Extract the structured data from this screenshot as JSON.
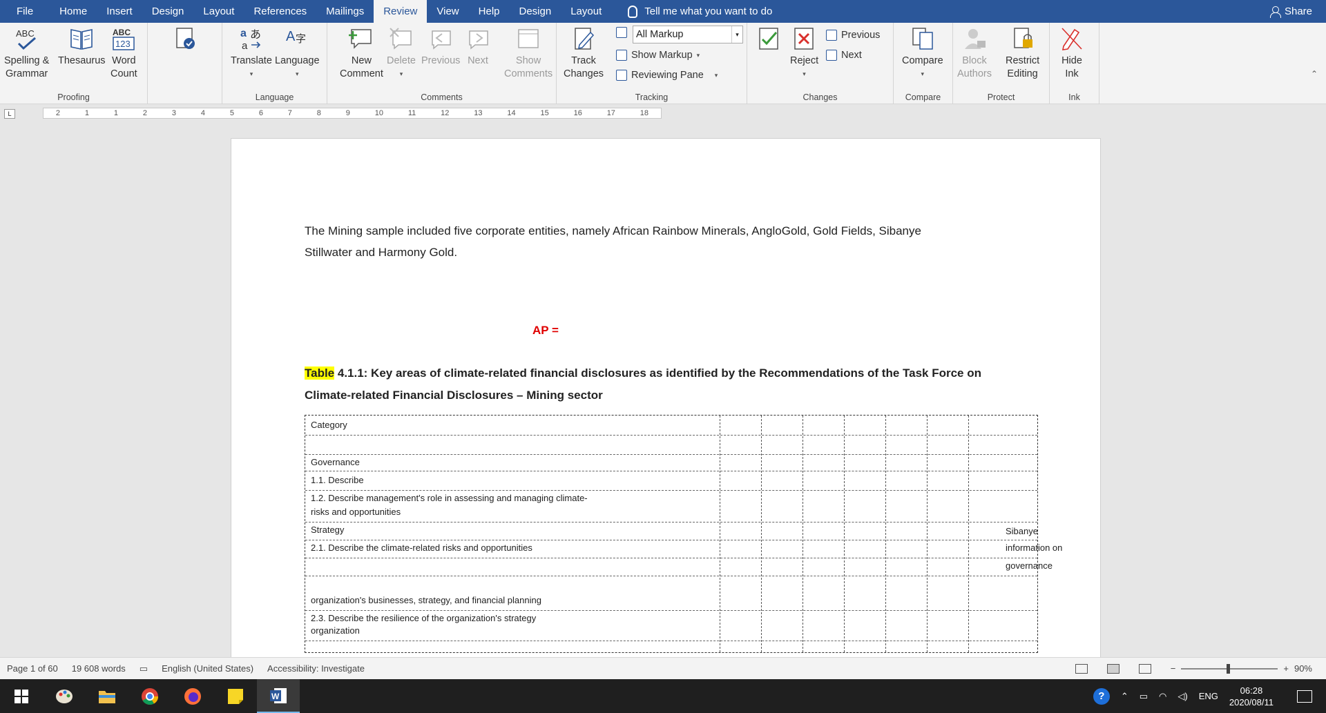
{
  "tabs": {
    "file": "File",
    "home": "Home",
    "insert": "Insert",
    "design": "Design",
    "layout": "Layout",
    "references": "References",
    "mailings": "Mailings",
    "review": "Review",
    "view": "View",
    "help": "Help",
    "design2": "Design",
    "layout2": "Layout"
  },
  "tellme": "Tell me what you want to do",
  "share": "Share",
  "ribbon": {
    "proofing": {
      "label": "Proofing",
      "spelling": "Spelling &",
      "grammar": "Grammar",
      "thesaurus": "Thesaurus",
      "wordcount1": "Word",
      "wordcount2": "Count"
    },
    "language": {
      "label": "Language",
      "translate": "Translate",
      "language": "Language"
    },
    "comments": {
      "label": "Comments",
      "new1": "New",
      "new2": "Comment",
      "delete": "Delete",
      "previous": "Previous",
      "next": "Next",
      "show1": "Show",
      "show2": "Comments"
    },
    "tracking": {
      "label": "Tracking",
      "track1": "Track",
      "track2": "Changes",
      "markup_value": "All Markup",
      "show_markup": "Show Markup",
      "reviewing_pane": "Reviewing Pane"
    },
    "changes": {
      "label": "Changes",
      "reject": "Reject",
      "previous": "Previous",
      "next": "Next"
    },
    "compare": {
      "label": "Compare",
      "compare": "Compare"
    },
    "protect": {
      "label": "Protect",
      "block1": "Block",
      "block2": "Authors",
      "restrict1": "Restrict",
      "restrict2": "Editing"
    },
    "ink": {
      "label": "Ink",
      "hide1": "Hide",
      "hide2": "Ink"
    }
  },
  "ruler": [
    "2",
    "1",
    "1",
    "2",
    "3",
    "4",
    "5",
    "6",
    "7",
    "8",
    "9",
    "10",
    "11",
    "12",
    "13",
    "14",
    "15",
    "16",
    "17",
    "18"
  ],
  "document": {
    "para1": "The Mining sample included five corporate entities, namely African Rainbow Minerals, AngloGold, Gold Fields, Sibanye",
    "para2": "Stillwater and Harmony Gold.",
    "ap_heading": "AP = ",
    "ap_express": "AP = ",
    "table_caption_1": "Table",
    "table_caption_2": " 4.1.1: Key areas of climate-related financial disclosures as identified by the Recommendations of the Task Force on",
    "table_caption_3": "Climate-related Financial Disclosures – Mining sector",
    "rows": {
      "category": "Category",
      "governance": "Governance",
      "r11": "1.1. Describe",
      "r12": "1.2. Describe management's role in assessing and managing climate-",
      "r12b": "risks and opportunities",
      "strategy": "Strategy",
      "r21": "2.1. Describe the climate-related risks and opportunities",
      "r22": "organization's businesses, strategy, and financial planning",
      "r23": "2.3. Describe the resilience of the organization's strategy",
      "r23b": "organization",
      "side1": "Sibanye",
      "side2": "information on",
      "side3": "governance"
    }
  },
  "status": {
    "page": "Page 1 of 60",
    "words": "19 608 words",
    "language": "English (United States)",
    "accessibility": "Accessibility: Investigate",
    "zoom": "90%"
  },
  "taskbar": {
    "lang": "ENG",
    "time": "06:28",
    "date": "2020/08/11"
  }
}
